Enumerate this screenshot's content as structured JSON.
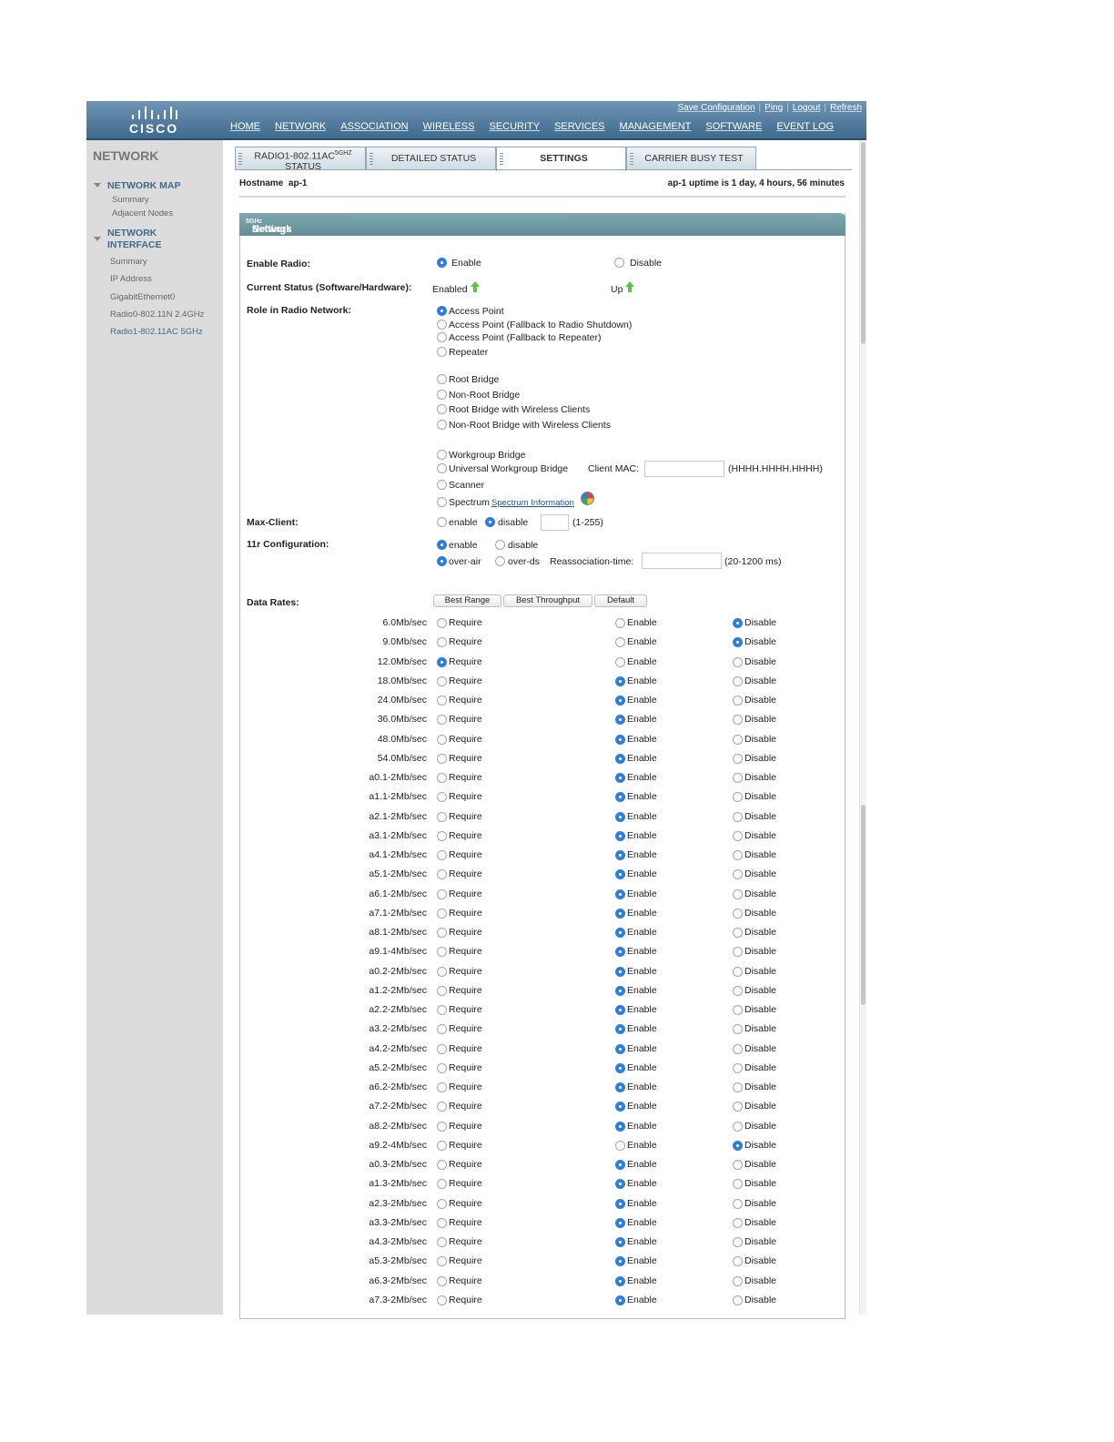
{
  "header": {
    "logo_text": "CISCO",
    "utils": [
      "Save Configuration",
      "Ping",
      "Logout",
      "Refresh"
    ],
    "nav": [
      "HOME",
      "NETWORK",
      "ASSOCIATION",
      "WIRELESS",
      "SECURITY",
      "SERVICES",
      "MANAGEMENT",
      "SOFTWARE",
      "EVENT LOG"
    ]
  },
  "sidebar": {
    "title": "NETWORK",
    "network_map": {
      "label": "NETWORK MAP",
      "items": [
        "Summary",
        "Adjacent Nodes"
      ]
    },
    "network_interface": {
      "label_line1": "NETWORK",
      "label_line2": "INTERFACE",
      "items": [
        "Summary",
        "IP Address",
        "GigabitEthernet0",
        "Radio0-802.11N 2.4GHz",
        "Radio1-802.11AC 5GHz"
      ]
    }
  },
  "tabs": {
    "radio_status_line1": "RADIO1-802.11AC",
    "radio_status_sup": "5GHZ",
    "radio_status_line2": "STATUS",
    "detailed_status": "DETAILED STATUS",
    "settings": "SETTINGS",
    "carrier_busy_test": "CARRIER BUSY TEST"
  },
  "hostname": {
    "label": "Hostname",
    "value": "ap-1",
    "uptime": "ap-1 uptime is 1 day, 4 hours, 56 minutes"
  },
  "panel": {
    "title_pre": "Network Interfaces: Radio1-802.11AC",
    "title_sup": "5GHz",
    "title_post": " Settings"
  },
  "enable_radio": {
    "label": "Enable Radio:",
    "opt_enable": "Enable",
    "opt_disable": "Disable",
    "selected": "Enable"
  },
  "current_status": {
    "label": "Current Status (Software/Hardware):",
    "software": "Enabled",
    "hardware": "Up"
  },
  "role": {
    "label": "Role in Radio Network:",
    "selected": "Access Point",
    "options": [
      "Access Point",
      "Access Point (Fallback to Radio Shutdown)",
      "Access Point (Fallback to Repeater)",
      "Repeater",
      "Root Bridge",
      "Non-Root Bridge",
      "Root Bridge with Wireless Clients",
      "Non-Root Bridge with Wireless Clients",
      "Workgroup Bridge",
      "Universal Workgroup Bridge",
      "Scanner",
      "Spectrum"
    ],
    "client_mac_label": "Client MAC:",
    "client_mac_value": "",
    "client_mac_hint": "(HHHH.HHHH.HHHH)",
    "spectrum_link": "Spectrum Information"
  },
  "max_client": {
    "label": "Max-Client:",
    "opt_enable": "enable",
    "opt_disable": "disable",
    "selected": "disable",
    "value": "",
    "hint": "(1-255)"
  },
  "r11_config": {
    "label": "11r Configuration:",
    "opt_enable": "enable",
    "opt_disable": "disable",
    "selected_mode": "enable",
    "opt_over_air": "over-air",
    "opt_over_ds": "over-ds",
    "selected_method": "over-air",
    "reassoc_label": "Reassociation-time:",
    "reassoc_value": "",
    "reassoc_hint": "(20-1200 ms)"
  },
  "data_rates": {
    "label": "Data Rates:",
    "buttons": [
      "Best Range",
      "Best Throughput",
      "Default"
    ],
    "opt_require": "Require",
    "opt_enable": "Enable",
    "opt_disable": "Disable",
    "rows": [
      {
        "rate": "6.0Mb/sec",
        "sel": "disable"
      },
      {
        "rate": "9.0Mb/sec",
        "sel": "disable"
      },
      {
        "rate": "12.0Mb/sec",
        "sel": "require"
      },
      {
        "rate": "18.0Mb/sec",
        "sel": "enable"
      },
      {
        "rate": "24.0Mb/sec",
        "sel": "enable"
      },
      {
        "rate": "36.0Mb/sec",
        "sel": "enable"
      },
      {
        "rate": "48.0Mb/sec",
        "sel": "enable"
      },
      {
        "rate": "54.0Mb/sec",
        "sel": "enable"
      },
      {
        "rate": "a0.1-2Mb/sec",
        "sel": "enable"
      },
      {
        "rate": "a1.1-2Mb/sec",
        "sel": "enable"
      },
      {
        "rate": "a2.1-2Mb/sec",
        "sel": "enable"
      },
      {
        "rate": "a3.1-2Mb/sec",
        "sel": "enable"
      },
      {
        "rate": "a4.1-2Mb/sec",
        "sel": "enable"
      },
      {
        "rate": "a5.1-2Mb/sec",
        "sel": "enable"
      },
      {
        "rate": "a6.1-2Mb/sec",
        "sel": "enable"
      },
      {
        "rate": "a7.1-2Mb/sec",
        "sel": "enable"
      },
      {
        "rate": "a8.1-2Mb/sec",
        "sel": "enable"
      },
      {
        "rate": "a9.1-4Mb/sec",
        "sel": "enable"
      },
      {
        "rate": "a0.2-2Mb/sec",
        "sel": "enable"
      },
      {
        "rate": "a1.2-2Mb/sec",
        "sel": "enable"
      },
      {
        "rate": "a2.2-2Mb/sec",
        "sel": "enable"
      },
      {
        "rate": "a3.2-2Mb/sec",
        "sel": "enable"
      },
      {
        "rate": "a4.2-2Mb/sec",
        "sel": "enable"
      },
      {
        "rate": "a5.2-2Mb/sec",
        "sel": "enable"
      },
      {
        "rate": "a6.2-2Mb/sec",
        "sel": "enable"
      },
      {
        "rate": "a7.2-2Mb/sec",
        "sel": "enable"
      },
      {
        "rate": "a8.2-2Mb/sec",
        "sel": "enable"
      },
      {
        "rate": "a9.2-4Mb/sec",
        "sel": "disable"
      },
      {
        "rate": "a0.3-2Mb/sec",
        "sel": "enable"
      },
      {
        "rate": "a1.3-2Mb/sec",
        "sel": "enable"
      },
      {
        "rate": "a2.3-2Mb/sec",
        "sel": "enable"
      },
      {
        "rate": "a3.3-2Mb/sec",
        "sel": "enable"
      },
      {
        "rate": "a4.3-2Mb/sec",
        "sel": "enable"
      },
      {
        "rate": "a5.3-2Mb/sec",
        "sel": "enable"
      },
      {
        "rate": "a6.3-2Mb/sec",
        "sel": "enable"
      },
      {
        "rate": "a7.3-2Mb/sec",
        "sel": "enable"
      }
    ]
  },
  "colors": {
    "header": "#3f6a8e",
    "panel_header": "#6f98a1",
    "radio_selected": "#2f7fd8",
    "status_arrow": "#5fc245"
  }
}
